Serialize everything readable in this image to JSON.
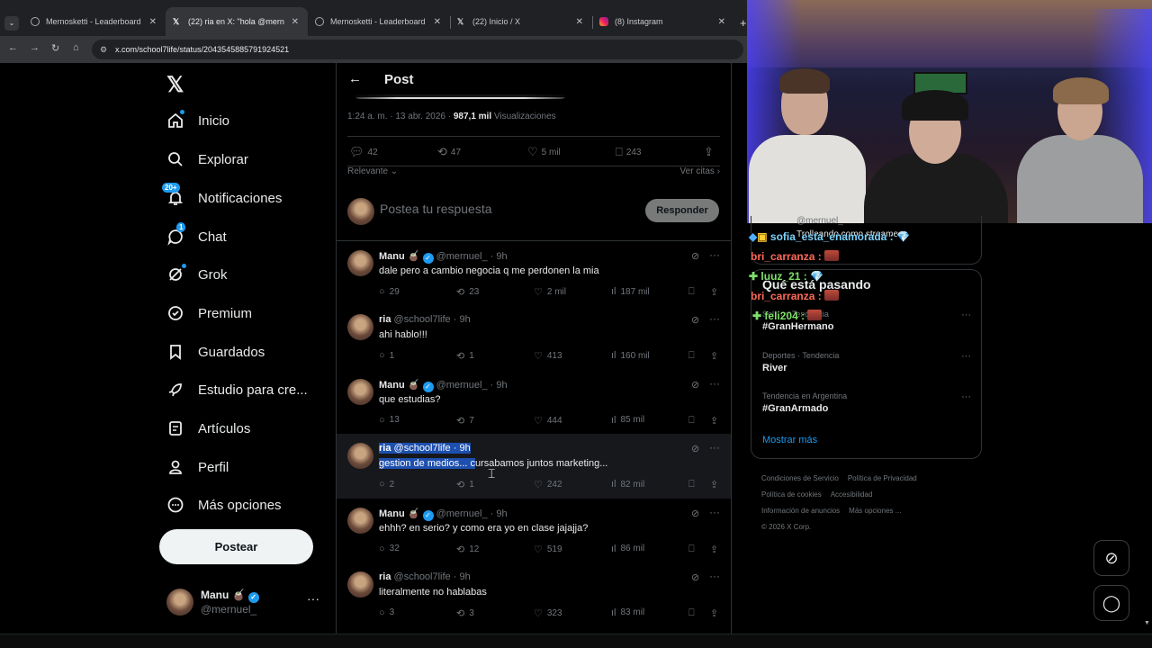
{
  "browser": {
    "tabs": [
      {
        "title": "Mernosketti - Leaderboard",
        "active": false
      },
      {
        "title": "(22) ria en X: \"hola @mernuel_",
        "active": true
      },
      {
        "title": "Mernosketti - Leaderboard",
        "active": false
      },
      {
        "title": "(22) Inicio / X",
        "active": false
      },
      {
        "title": "(8) Instagram",
        "active": false
      }
    ],
    "url": "x.com/school7life/status/2043545885791924521"
  },
  "sidebar": {
    "items": [
      {
        "label": "Inicio",
        "icon": "home-icon"
      },
      {
        "label": "Explorar",
        "icon": "search-icon"
      },
      {
        "label": "Notificaciones",
        "icon": "bell-icon",
        "badge": "20+"
      },
      {
        "label": "Chat",
        "icon": "chat-icon"
      },
      {
        "label": "Grok",
        "icon": "grok-icon"
      },
      {
        "label": "Premium",
        "icon": "premium-icon"
      },
      {
        "label": "Guardados",
        "icon": "bookmark-icon"
      },
      {
        "label": "Estudio para cre...",
        "icon": "rocket-icon"
      },
      {
        "label": "Artículos",
        "icon": "articles-icon"
      },
      {
        "label": "Perfil",
        "icon": "person-icon"
      },
      {
        "label": "Más opciones",
        "icon": "more-circle-icon"
      }
    ],
    "post_button": "Postear",
    "account": {
      "name": "Manu",
      "handle": "@mernuel_"
    }
  },
  "post": {
    "header_title": "Post",
    "timestamp": "1:24 a. m. · 13 abr. 2026 ·",
    "views_count": "987,1 mil",
    "views_label": "Visualizaciones",
    "stats": {
      "replies": "42",
      "reposts": "47",
      "likes": "5 mil",
      "bookmarks": "243"
    },
    "sort_label": "Relevante",
    "quotes_label": "Ver citas",
    "reply_placeholder": "Postea tu respuesta",
    "reply_button": "Responder"
  },
  "comments": [
    {
      "name": "Manu",
      "handle": "@mernuel_",
      "time": "· 9h",
      "verified": true,
      "text": "dale pero a cambio negocia q me perdonen la mia",
      "replies": "29",
      "reposts": "23",
      "likes": "2 mil",
      "views": "187 mil"
    },
    {
      "name": "ria",
      "handle": "@school7life",
      "time": "· 9h",
      "verified": false,
      "text": "ahi hablo!!!",
      "replies": "1",
      "reposts": "1",
      "likes": "413",
      "views": "160 mil"
    },
    {
      "name": "Manu",
      "handle": "@mernuel_",
      "time": "· 9h",
      "verified": true,
      "text": "que estudias?",
      "replies": "13",
      "reposts": "7",
      "likes": "444",
      "views": "85 mil"
    },
    {
      "name": "ria",
      "handle": "@school7life",
      "time": "· 9h",
      "verified": false,
      "text_selected": "gestion de medios... c",
      "text_rest": "ursabamos juntos marketing...",
      "replies": "2",
      "reposts": "1",
      "likes": "242",
      "views": "82 mil",
      "highlighted": true
    },
    {
      "name": "Manu",
      "handle": "@mernuel_",
      "time": "· 9h",
      "verified": true,
      "text": "ehhh? en serio? y como era yo en clase jajajja?",
      "replies": "32",
      "reposts": "12",
      "likes": "519",
      "views": "86 mil"
    },
    {
      "name": "ria",
      "handle": "@school7life",
      "time": "· 9h",
      "verified": false,
      "text": "literalmente no hablabas",
      "replies": "3",
      "reposts": "3",
      "likes": "323",
      "views": "83 mil"
    }
  ],
  "right_panel": {
    "top_handle": "@mernuel_",
    "top_text": "Trolleando como streamer",
    "trends_title": "Qué está pasando",
    "trends": [
      {
        "category": "Solo en Tendencia",
        "name": "#GranHermano"
      },
      {
        "category": "Deportes · Tendencia",
        "name": "River"
      },
      {
        "category": "Tendencia en Argentina",
        "name": "#GranArmado"
      }
    ],
    "show_more": "Mostrar más",
    "footer_links": [
      "Condiciones de Servicio",
      "Política de Privacidad",
      "Política de cookies",
      "Accesibilidad",
      "Información de anuncios",
      "Más opciones ...",
      "© 2026 X Corp."
    ]
  },
  "chat_overlay": [
    {
      "user": "sofia_esta_enamorada",
      "color": "#7dd3fc"
    },
    {
      "user": "bri_carranza",
      "color": "#ff6b5b"
    },
    {
      "user": "luuz_21",
      "color": "#7fe06a"
    },
    {
      "user": "bri_carranza",
      "color": "#ff6b5b"
    },
    {
      "user": "feli204",
      "color": "#7fe06a"
    }
  ],
  "colors": {
    "accent": "#1d9bf0",
    "background": "#000000",
    "text": "#e7e9ea",
    "muted": "#71767b",
    "selection": "#1d4fae"
  }
}
